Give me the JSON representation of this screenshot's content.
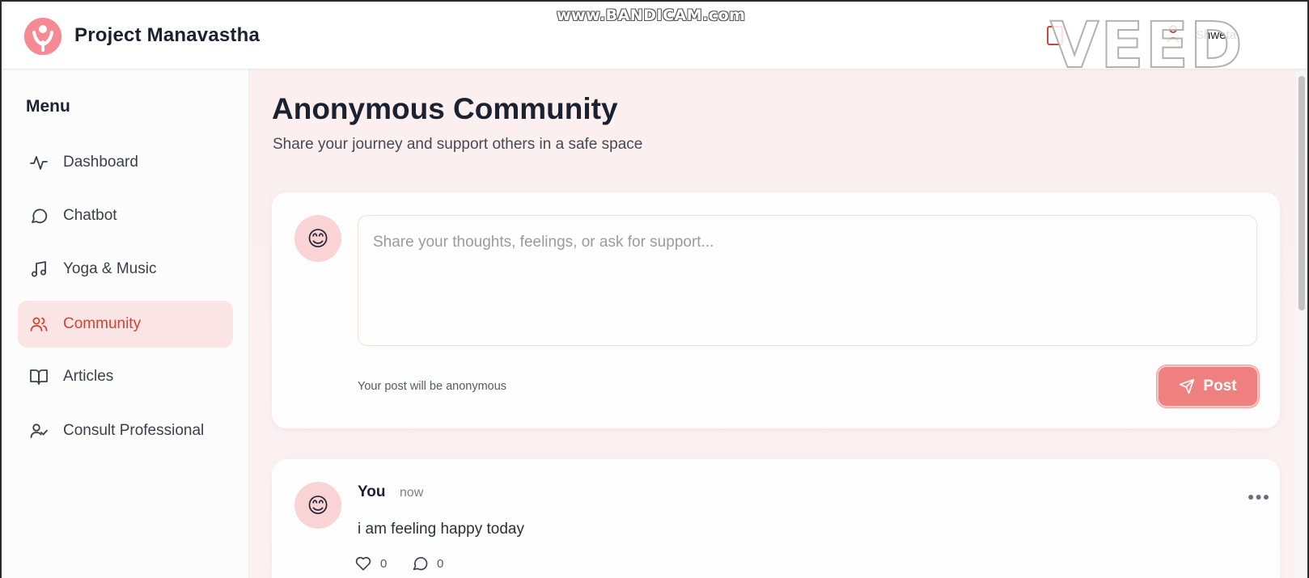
{
  "app": {
    "brand": "Project Manavastha",
    "user_name": "Shweta"
  },
  "watermarks": {
    "bandicam": "www.BANDICAM.com",
    "veed": "VEED"
  },
  "sidebar": {
    "title": "Menu",
    "items": [
      {
        "label": "Dashboard",
        "icon": "activity-icon",
        "active": false
      },
      {
        "label": "Chatbot",
        "icon": "chat-bubble-icon",
        "active": false
      },
      {
        "label": "Yoga & Music",
        "icon": "music-note-icon",
        "active": false
      },
      {
        "label": "Community",
        "icon": "users-icon",
        "active": true
      },
      {
        "label": "Articles",
        "icon": "book-open-icon",
        "active": false
      },
      {
        "label": "Consult Professional",
        "icon": "user-check-icon",
        "active": false
      }
    ]
  },
  "page": {
    "title": "Anonymous Community",
    "subtitle": "Share your journey and support others in a safe space"
  },
  "composer": {
    "avatar_emoji": "😊",
    "placeholder": "Share your thoughts, feelings, or ask for support...",
    "value": "",
    "note": "Your post will be anonymous",
    "post_label": "Post"
  },
  "posts": [
    {
      "avatar_emoji": "😊",
      "author": "You",
      "time": "now",
      "body": "i am feeling happy today",
      "likes": "0",
      "comments": "0"
    }
  ],
  "colors": {
    "accent": "#ef8080",
    "active_nav_bg": "#fbe4e4",
    "active_nav_text": "#c9483a",
    "page_bg": "#fbeff0"
  }
}
